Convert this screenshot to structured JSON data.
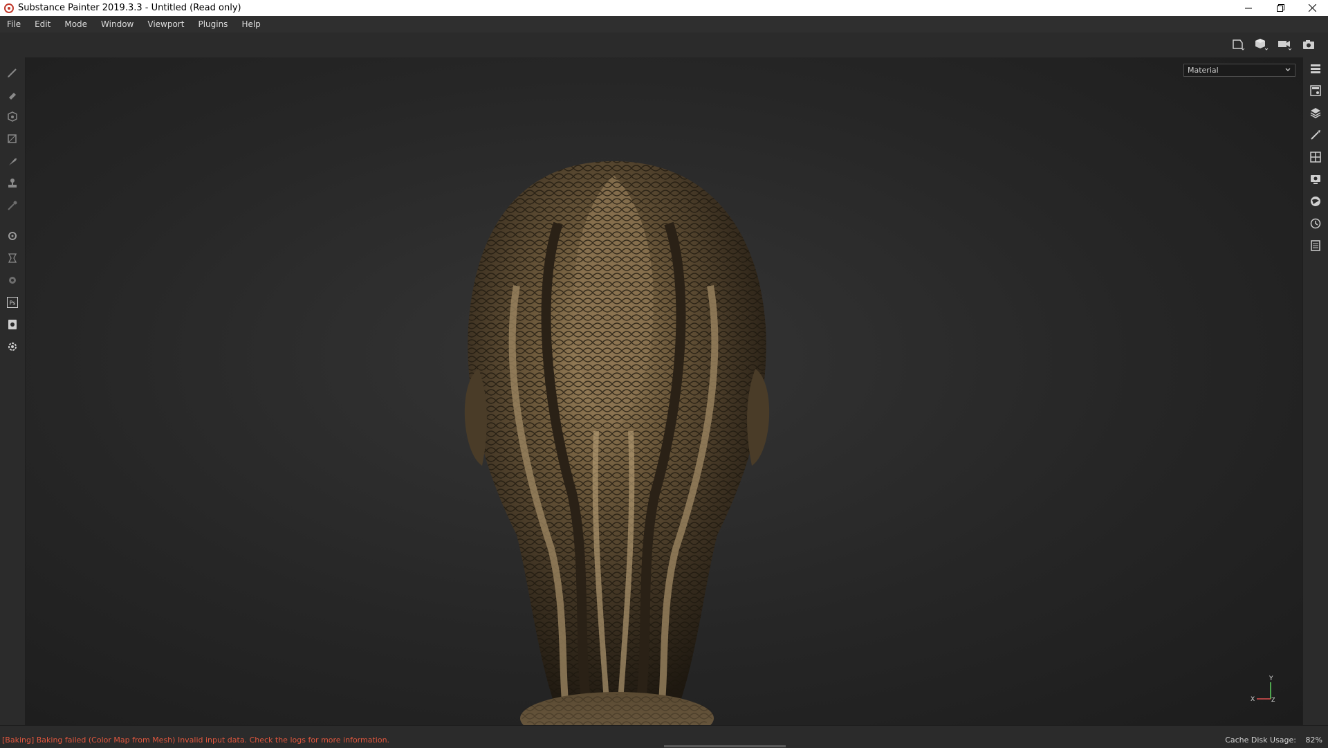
{
  "window": {
    "title": "Substance Painter 2019.3.3 - Untitled (Read only)",
    "controls": [
      "minimize-icon",
      "restore-icon",
      "close-icon"
    ]
  },
  "menu": {
    "items": [
      "File",
      "Edit",
      "Mode",
      "Window",
      "Viewport",
      "Plugins",
      "Help"
    ]
  },
  "viewport": {
    "mode_select": {
      "value": "Material"
    },
    "axis": {
      "y": "Y",
      "x": "X",
      "z": "Z"
    },
    "tools": [
      "display-frame-icon",
      "view-cube-icon",
      "camera-icon",
      "screenshot-icon"
    ]
  },
  "left_toolbar": {
    "tools": [
      "paint-brush-icon",
      "eraser-icon",
      "projection-icon",
      "polygon-fill-icon",
      "smudge-icon",
      "clone-stamp-icon",
      "color-picker-icon",
      "bake-settings-icon",
      "export-icon",
      "iray-icon",
      "photoshop-icon",
      "material-export-icon",
      "settings-icon"
    ],
    "photoshop_label": "Ps"
  },
  "right_toolbar": {
    "tools": [
      "layers-panel-icon",
      "texture-set-list-icon",
      "stack-icon",
      "properties-icon",
      "texture-set-settings-icon",
      "display-settings-icon",
      "environment-icon",
      "history-icon",
      "log-icon"
    ]
  },
  "status": {
    "message": "[Baking] Baking failed (Color Map from Mesh) Invalid input data. Check the logs for more information.",
    "cache_label": "Cache Disk Usage:",
    "cache_value": "82%",
    "error_color": "#e0573e"
  }
}
